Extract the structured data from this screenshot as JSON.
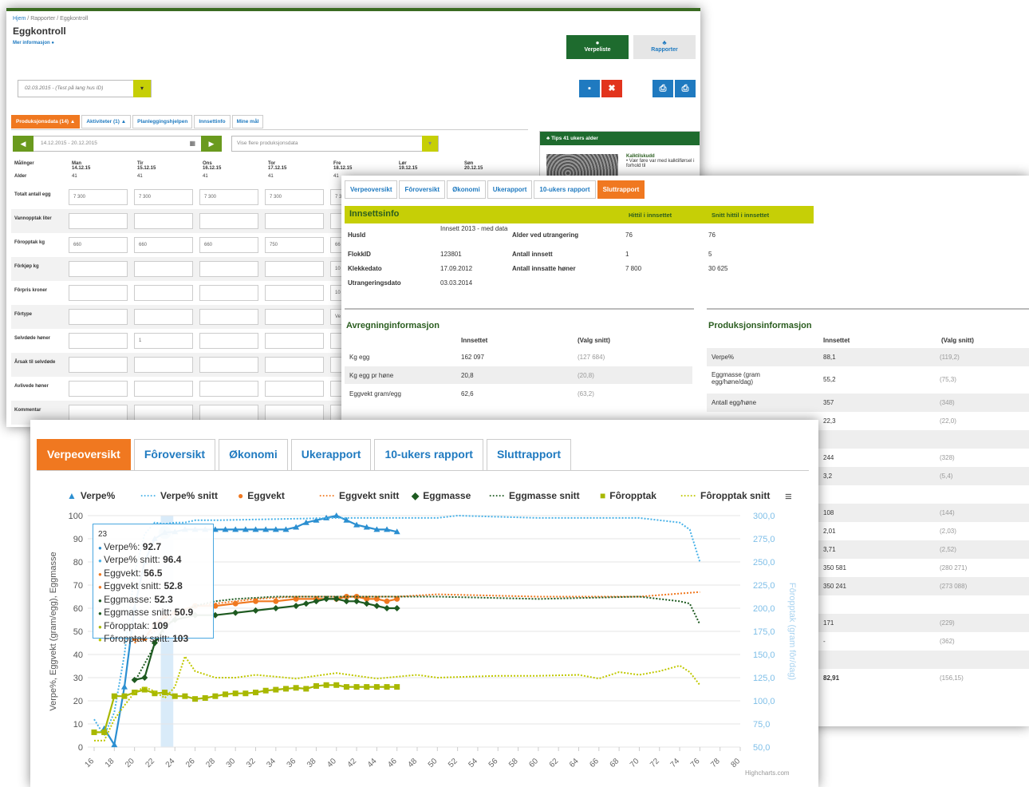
{
  "egg": {
    "breadcrumb": [
      "Hjem",
      "Rapporter",
      "Eggkontroll"
    ],
    "title": "Eggkontroll",
    "mer_info": "Mer informasjon ●",
    "nav": [
      {
        "label": "Verpeliste",
        "icon": "●",
        "bg": "#1e6b2e",
        "color": "#fff"
      },
      {
        "label": "Rapporter",
        "icon": "♣",
        "bg": "#e6e6e6",
        "color": "#1f7ac0"
      }
    ],
    "dropdown": "02.03.2015 - (Test på lang hus ID)",
    "dropdown_arrow": "▾",
    "save_icon": "▪",
    "cancel_icon": "✖",
    "export_icon": "⎙",
    "print_icon": "⎙",
    "tabs": [
      "Produksjonsdata (14) ▲",
      "Aktiviteter (1) ▲",
      "Planleggingshjelpen",
      "Innsettinfo",
      "Mine mål"
    ],
    "date_range": "14.12.2015 - 20.12.2015",
    "prev": "◀",
    "next": "▶",
    "cal_icon": "▦",
    "vise": "Vise flere produksjonsdata",
    "vise_arrow": "▾",
    "tip_title": "♣ Tips 41 ukers alder",
    "tip_heading": "Kalktilskudd",
    "tip_text": "• Vær føre var med kalktilførsel i forhold til",
    "head_label": "Målinger",
    "days": [
      "Man 14.12.15",
      "Tir 15.12.15",
      "Ons 16.12.15",
      "Tor 17.12.15",
      "Fre 18.12.15",
      "Lør 19.12.15",
      "Søn 20.12.15"
    ],
    "alder_label": "Alder",
    "alder": [
      "41",
      "41",
      "41",
      "41",
      "41"
    ],
    "rows": [
      {
        "label": "Totalt antall egg",
        "vals": [
          "7 300",
          "7 300",
          "7 300",
          "7 300",
          "7 3"
        ]
      },
      {
        "label": "Vannopptak liter",
        "vals": [
          "",
          "",
          "",
          "",
          ""
        ]
      },
      {
        "label": "Fôropptak kg",
        "vals": [
          "660",
          "660",
          "660",
          "750",
          "66"
        ]
      },
      {
        "label": "Fôrkjøp kg",
        "vals": [
          "",
          "",
          "",
          "",
          "10"
        ]
      },
      {
        "label": "Fôrpris kroner",
        "vals": [
          "",
          "",
          "",
          "",
          "10"
        ]
      },
      {
        "label": "Fôrtype",
        "vals": [
          "",
          "",
          "",
          "",
          "Ve"
        ]
      },
      {
        "label": "Selvdøde høner",
        "vals": [
          "",
          "1",
          "",
          "",
          ""
        ]
      },
      {
        "label": "Årsak til selvdøde",
        "vals": [
          "",
          "",
          "",
          "",
          ""
        ]
      },
      {
        "label": "Avlivede høner",
        "vals": [
          "",
          "",
          "",
          "",
          ""
        ]
      },
      {
        "label": "Kommentar",
        "vals": [
          "",
          "",
          "",
          "",
          ""
        ]
      }
    ]
  },
  "slutt": {
    "tabs": [
      "Verpeoversikt",
      "Fôroversikt",
      "Økonomi",
      "Ukerapport",
      "10-ukers rapport",
      "Sluttrapport"
    ],
    "info_title": "Innsettsinfo",
    "col_hittil": "Hittil i innsettet",
    "col_snitt": "Snitt hittil i innsettet",
    "info_left": [
      {
        "k": "HusId",
        "v": "Innsett 2013 - med data"
      },
      {
        "k": "FlokkID",
        "v": "123801"
      },
      {
        "k": "Klekkedato",
        "v": "17.09.2012"
      },
      {
        "k": "Utrangeringsdato",
        "v": "03.03.2014"
      }
    ],
    "info_right": [
      {
        "k": "Alder ved utrangering",
        "v": "76",
        "s": "76"
      },
      {
        "k": "Antall innsett",
        "v": "1",
        "s": "5"
      },
      {
        "k": "Antall innsatte høner",
        "v": "7 800",
        "s": "30 625"
      }
    ],
    "avr_title": "Avregninginformasjon",
    "prod_title": "Produksjonsinformasjon",
    "col_innsett": "Innsettet",
    "col_valg": "(Valg snitt)",
    "avr_rows": [
      {
        "k": "Kg egg",
        "v": "162 097",
        "s": "(127 684)"
      },
      {
        "k": "Kg egg pr høne",
        "v": "20,8",
        "s": "(20,8)"
      },
      {
        "k": "Eggvekt gram/egg",
        "v": "62,6",
        "s": "(63,2)"
      }
    ],
    "prod_rows": [
      {
        "k": "Verpe%",
        "v": "88,1",
        "s": "(119,2)"
      },
      {
        "k": "Eggmasse (gram egg/høne/dag)",
        "v": "55,2",
        "s": "(75,3)"
      },
      {
        "k": "Antall egg/høne",
        "v": "357",
        "s": "(348)"
      },
      {
        "k": "",
        "v": "22,3",
        "s": "(22,0)"
      },
      {
        "k": "",
        "v": "",
        "s": ""
      },
      {
        "k": "",
        "v": "244",
        "s": "(328)"
      },
      {
        "k": "",
        "v": "3,2",
        "s": "(5,4)"
      },
      {
        "k": "",
        "v": "",
        "s": ""
      },
      {
        "k": "",
        "v": "108",
        "s": "(144)"
      },
      {
        "k": "",
        "v": "2,01",
        "s": "(2,03)"
      },
      {
        "k": "",
        "v": "3,71",
        "s": "(2,52)"
      },
      {
        "k": "",
        "v": "350 581",
        "s": "(280 271)"
      },
      {
        "k": "",
        "v": "350 241",
        "s": "(273 088)"
      },
      {
        "k": "",
        "v": "",
        "s": ""
      },
      {
        "k": "",
        "v": "171",
        "s": "(229)"
      },
      {
        "k": "",
        "v": "-",
        "s": "(362)"
      },
      {
        "k": "",
        "v": "",
        "s": ""
      },
      {
        "k": "",
        "v": "82,91",
        "s": "(156,15)"
      }
    ]
  },
  "verpe": {
    "tabs": [
      "Verpeoversikt",
      "Fôroversikt",
      "Økonomi",
      "Ukerapport",
      "10-ukers rapport",
      "Sluttrapport"
    ],
    "menu_icon": "≡",
    "credit": "Highcharts.com",
    "legend": [
      {
        "sym": "▲",
        "label": "Verpe%",
        "color": "#2b8fd1"
      },
      {
        "sym": "·····",
        "label": "Verpe% snitt",
        "color": "#49b2e8"
      },
      {
        "sym": "●",
        "label": "Eggvekt",
        "color": "#f07820"
      },
      {
        "sym": "·····",
        "label": "Eggvekt snitt",
        "color": "#f07820"
      },
      {
        "sym": "◆",
        "label": "Eggmasse",
        "color": "#1e5a20"
      },
      {
        "sym": "·····",
        "label": "Eggmasse snitt",
        "color": "#1e5a20"
      },
      {
        "sym": "■",
        "label": "Fôropptak",
        "color": "#a8b800"
      },
      {
        "sym": "·····",
        "label": "Fôropptak snitt",
        "color": "#c0c800"
      }
    ],
    "tooltip": {
      "header": "23",
      "rows": [
        {
          "k": "Verpe%",
          "v": "92.7",
          "color": "#2b8fd1"
        },
        {
          "k": "Verpe% snitt",
          "v": "96.4",
          "color": "#49b2e8"
        },
        {
          "k": "Eggvekt",
          "v": "56.5",
          "color": "#f07820"
        },
        {
          "k": "Eggvekt snitt",
          "v": "52.8",
          "color": "#f07820"
        },
        {
          "k": "Eggmasse",
          "v": "52.3",
          "color": "#1e5a20"
        },
        {
          "k": "Eggmasse snitt",
          "v": "50.9",
          "color": "#1e5a20"
        },
        {
          "k": "Fôropptak",
          "v": "109",
          "color": "#a8b800"
        },
        {
          "k": "Fôropptak snitt",
          "v": "103",
          "color": "#c0c800"
        }
      ]
    }
  },
  "chart_data": {
    "type": "line",
    "x": [
      16,
      18,
      20,
      22,
      24,
      26,
      28,
      30,
      32,
      34,
      36,
      38,
      40,
      42,
      44,
      46,
      48,
      50,
      52,
      54,
      56,
      58,
      60,
      62,
      64,
      66,
      68,
      70,
      72,
      74,
      76,
      78,
      80
    ],
    "xlim": [
      16,
      80
    ],
    "ylim": [
      0,
      100
    ],
    "y2lim": [
      50,
      300
    ],
    "ylabel": "Verpe%, Eggvekt (gram/egg), Eggmasse",
    "y2label": "Fôropptak (gram fôr/dag)",
    "yticks": [
      "0",
      "10",
      "20",
      "30",
      "40",
      "50",
      "60",
      "70",
      "80",
      "90",
      "100"
    ],
    "y2ticks": [
      "50,0",
      "75,0",
      "100,0",
      "125,0",
      "150,0",
      "175,0",
      "200,0",
      "225,0",
      "250,0",
      "275,0",
      "300,0"
    ],
    "series": [
      {
        "name": "Verpe%",
        "color": "#2b8fd1",
        "dash": "",
        "marker": "tri",
        "points": [
          [
            17,
            8
          ],
          [
            18,
            1
          ],
          [
            19,
            26
          ],
          [
            20,
            60
          ],
          [
            21,
            80
          ],
          [
            22,
            90
          ],
          [
            23,
            92.7
          ],
          [
            24,
            93
          ],
          [
            25,
            94
          ],
          [
            26,
            94
          ],
          [
            27,
            94
          ],
          [
            28,
            94
          ],
          [
            29,
            94
          ],
          [
            30,
            94
          ],
          [
            31,
            94
          ],
          [
            32,
            94
          ],
          [
            33,
            94
          ],
          [
            34,
            94
          ],
          [
            35,
            94
          ],
          [
            36,
            95
          ],
          [
            37,
            97
          ],
          [
            38,
            98
          ],
          [
            39,
            99
          ],
          [
            40,
            100
          ],
          [
            41,
            98
          ],
          [
            42,
            96
          ],
          [
            43,
            95
          ],
          [
            44,
            94
          ],
          [
            45,
            94
          ],
          [
            46,
            93
          ]
        ]
      },
      {
        "name": "Verpe% snitt",
        "color": "#49b2e8",
        "dash": "2,2",
        "marker": "",
        "points": [
          [
            16,
            12
          ],
          [
            17,
            5
          ],
          [
            18,
            15
          ],
          [
            19,
            40
          ],
          [
            20,
            75
          ],
          [
            21,
            92
          ],
          [
            22,
            97
          ],
          [
            23,
            96.4
          ],
          [
            24,
            97
          ],
          [
            25,
            97
          ],
          [
            26,
            98
          ],
          [
            28,
            98
          ],
          [
            40,
            99
          ],
          [
            50,
            99
          ],
          [
            52,
            100
          ],
          [
            60,
            99
          ],
          [
            70,
            99
          ],
          [
            72,
            98
          ],
          [
            74,
            97
          ],
          [
            75,
            94
          ],
          [
            76,
            80
          ]
        ]
      },
      {
        "name": "Eggvekt",
        "color": "#f07820",
        "dash": "",
        "marker": "dot",
        "points": [
          [
            20,
            47
          ],
          [
            21,
            47
          ],
          [
            22,
            53
          ],
          [
            23,
            56.5
          ],
          [
            24,
            58
          ],
          [
            26,
            61
          ],
          [
            28,
            61
          ],
          [
            30,
            62
          ],
          [
            32,
            63
          ],
          [
            34,
            63
          ],
          [
            36,
            64
          ],
          [
            38,
            64
          ],
          [
            40,
            64
          ],
          [
            41,
            65
          ],
          [
            42,
            65
          ],
          [
            43,
            64
          ],
          [
            44,
            64
          ],
          [
            45,
            63
          ],
          [
            46,
            64
          ]
        ]
      },
      {
        "name": "Eggvekt snitt",
        "color": "#f07820",
        "dash": "2,2",
        "marker": "",
        "points": [
          [
            20,
            45
          ],
          [
            22,
            50
          ],
          [
            23,
            52.8
          ],
          [
            24,
            58
          ],
          [
            26,
            61
          ],
          [
            28,
            62
          ],
          [
            30,
            63
          ],
          [
            32,
            64
          ],
          [
            36,
            65
          ],
          [
            46,
            65
          ],
          [
            50,
            66
          ],
          [
            60,
            65
          ],
          [
            70,
            65
          ],
          [
            76,
            67
          ]
        ]
      },
      {
        "name": "Eggmasse",
        "color": "#1e5a20",
        "dash": "",
        "marker": "dia",
        "points": [
          [
            20,
            29
          ],
          [
            21,
            30
          ],
          [
            22,
            45
          ],
          [
            23,
            52.3
          ],
          [
            24,
            55
          ],
          [
            26,
            57
          ],
          [
            28,
            57
          ],
          [
            30,
            58
          ],
          [
            32,
            59
          ],
          [
            34,
            60
          ],
          [
            36,
            61
          ],
          [
            37,
            62
          ],
          [
            38,
            63
          ],
          [
            39,
            64
          ],
          [
            40,
            64
          ],
          [
            41,
            63
          ],
          [
            42,
            63
          ],
          [
            43,
            62
          ],
          [
            44,
            61
          ],
          [
            45,
            60
          ],
          [
            46,
            60
          ]
        ]
      },
      {
        "name": "Eggmasse snitt",
        "color": "#1e5a20",
        "dash": "2,2",
        "marker": "",
        "points": [
          [
            20,
            28
          ],
          [
            22,
            44
          ],
          [
            23,
            50.9
          ],
          [
            24,
            56
          ],
          [
            26,
            61
          ],
          [
            28,
            63
          ],
          [
            30,
            64
          ],
          [
            34,
            65
          ],
          [
            46,
            65
          ],
          [
            50,
            65
          ],
          [
            60,
            64
          ],
          [
            70,
            65
          ],
          [
            74,
            63
          ],
          [
            75,
            62
          ],
          [
            76,
            53
          ]
        ]
      },
      {
        "name": "Fôropptak",
        "color": "#a8b800",
        "dash": "",
        "marker": "sq",
        "points": [
          [
            16,
            66
          ],
          [
            17,
            66
          ],
          [
            18,
            105
          ],
          [
            19,
            105
          ],
          [
            20,
            109
          ],
          [
            21,
            112
          ],
          [
            22,
            108
          ],
          [
            23,
            109
          ],
          [
            24,
            105
          ],
          [
            25,
            105
          ],
          [
            26,
            102
          ],
          [
            27,
            103
          ],
          [
            28,
            105
          ],
          [
            29,
            107
          ],
          [
            30,
            108
          ],
          [
            31,
            108
          ],
          [
            32,
            109
          ],
          [
            33,
            111
          ],
          [
            34,
            112
          ],
          [
            35,
            113
          ],
          [
            36,
            114
          ],
          [
            37,
            113
          ],
          [
            38,
            116
          ],
          [
            39,
            117
          ],
          [
            40,
            117
          ],
          [
            41,
            115
          ],
          [
            42,
            115
          ],
          [
            43,
            115
          ],
          [
            44,
            115
          ],
          [
            45,
            115
          ],
          [
            46,
            115
          ]
        ]
      },
      {
        "name": "Fôropptak snitt",
        "color": "#c0c800",
        "dash": "2,2",
        "marker": "",
        "points": [
          [
            16,
            57
          ],
          [
            17,
            57
          ],
          [
            18,
            80
          ],
          [
            19,
            95
          ],
          [
            20,
            109
          ],
          [
            21,
            115
          ],
          [
            22,
            110
          ],
          [
            23,
            103
          ],
          [
            24,
            115
          ],
          [
            25,
            148
          ],
          [
            26,
            132
          ],
          [
            28,
            125
          ],
          [
            30,
            125
          ],
          [
            32,
            128
          ],
          [
            34,
            126
          ],
          [
            36,
            124
          ],
          [
            40,
            130
          ],
          [
            44,
            124
          ],
          [
            48,
            128
          ],
          [
            50,
            125
          ],
          [
            56,
            127
          ],
          [
            60,
            127
          ],
          [
            64,
            128
          ],
          [
            66,
            124
          ],
          [
            68,
            131
          ],
          [
            70,
            128
          ],
          [
            72,
            132
          ],
          [
            74,
            138
          ],
          [
            75,
            131
          ],
          [
            76,
            117
          ]
        ]
      }
    ]
  }
}
